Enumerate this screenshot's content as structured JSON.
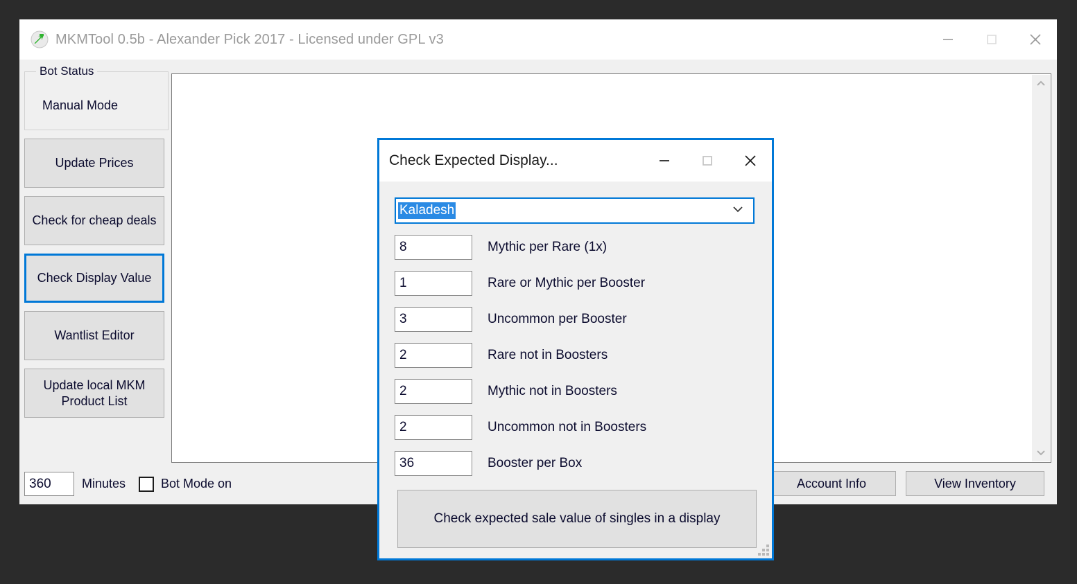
{
  "window": {
    "title": "MKMTool 0.5b - Alexander Pick 2017 - Licensed under GPL v3",
    "icon": "green-arrow-icon",
    "controls": {
      "minimize": "minimize-icon",
      "maximize": "maximize-icon",
      "close": "close-icon"
    }
  },
  "sidebar": {
    "bot_status": {
      "legend": "Bot Status",
      "value": "Manual Mode"
    },
    "buttons": [
      {
        "label": "Update Prices",
        "focused": false
      },
      {
        "label": "Check for cheap deals",
        "focused": false
      },
      {
        "label": "Check Display Value",
        "focused": true
      },
      {
        "label": "Wantlist Editor",
        "focused": false
      },
      {
        "label": "Update local MKM Product List",
        "focused": false
      }
    ]
  },
  "bottom_bar": {
    "minutes_value": "360",
    "minutes_label": "Minutes",
    "bot_mode_label": "Bot Mode on",
    "bot_mode_checked": false,
    "account_info_label": "Account Info",
    "view_inventory_label": "View Inventory"
  },
  "dialog": {
    "title": "Check Expected Display...",
    "controls": {
      "minimize": "minimize-icon",
      "maximize": "maximize-icon",
      "close": "close-icon"
    },
    "set_select": {
      "value": "Kaladesh",
      "selected": true
    },
    "fields": [
      {
        "value": "8",
        "label": "Mythic per Rare (1x)"
      },
      {
        "value": "1",
        "label": "Rare or Mythic per Booster"
      },
      {
        "value": "3",
        "label": "Uncommon per Booster"
      },
      {
        "value": "2",
        "label": "Rare not in Boosters"
      },
      {
        "value": "2",
        "label": "Mythic not in Boosters"
      },
      {
        "value": "2",
        "label": "Uncommon not in Boosters"
      },
      {
        "value": "36",
        "label": "Booster per Box"
      }
    ],
    "action_label": "Check expected sale value of singles in a display"
  },
  "colors": {
    "accent": "#0078d7",
    "selection": "#2a8ae4",
    "window_bg": "#f0f0f0",
    "desktop": "#2b2b2b"
  }
}
